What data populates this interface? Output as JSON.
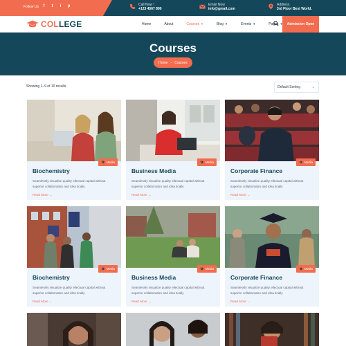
{
  "topbar": {
    "follow": "Follow Us",
    "socials": [
      "f",
      "t",
      "i",
      "p"
    ],
    "call": {
      "label": "Call Now !",
      "value": "+123 4567 890"
    },
    "email": {
      "label": "Email Now",
      "value": "info@gmail.com"
    },
    "address": {
      "label": "Address",
      "value": "3rd Floor Best World."
    }
  },
  "logo": {
    "part1": "COL",
    "part2": "LEGE"
  },
  "menu": [
    {
      "label": "Home",
      "dropdown": false
    },
    {
      "label": "About",
      "dropdown": false
    },
    {
      "label": "Courses",
      "dropdown": true
    },
    {
      "label": "Blog",
      "dropdown": true
    },
    {
      "label": "Events",
      "dropdown": true
    },
    {
      "label": "Pages",
      "dropdown": true
    }
  ],
  "admission": "Admission Open",
  "banner": {
    "title": "Courses",
    "crumb_home": "Home",
    "crumb_sep": "-",
    "crumb_current": "Courses"
  },
  "results": "Showing 1–9 of 10 results",
  "sort": {
    "selected": "Default Sorting"
  },
  "cards": [
    {
      "title": "Biochemistry",
      "badge": "Media",
      "desc": "Seamlessly visualize quality ellectual capital without superior collaboration and idea tically",
      "read": "Read More →"
    },
    {
      "title": "Business Media",
      "badge": "Media",
      "desc": "Seamlessly visualize quality ellectual capital without superior collaboration and idea tically",
      "read": "Read More →"
    },
    {
      "title": "Corporate Finance",
      "badge": "Media",
      "desc": "Seamlessly visualize quality ellectual capital without superior collaboration and idea tically",
      "read": "Read More →"
    },
    {
      "title": "Biochemistry",
      "badge": "Media",
      "desc": "Seamlessly visualize quality ellectual capital without superior collaboration and idea tically",
      "read": "Read More →"
    },
    {
      "title": "Business Media",
      "badge": "Media",
      "desc": "Seamlessly visualize quality ellectual capital without superior collaboration and idea tically",
      "read": "Read More →"
    },
    {
      "title": "Corporate Finance",
      "badge": "Media",
      "desc": "Seamlessly visualize quality ellectual capital without superior collaboration and idea tically",
      "read": "Read More →"
    }
  ],
  "colors": {
    "accent": "#f26c4f",
    "primary": "#14475a",
    "card_bg": "#eef4fb"
  }
}
